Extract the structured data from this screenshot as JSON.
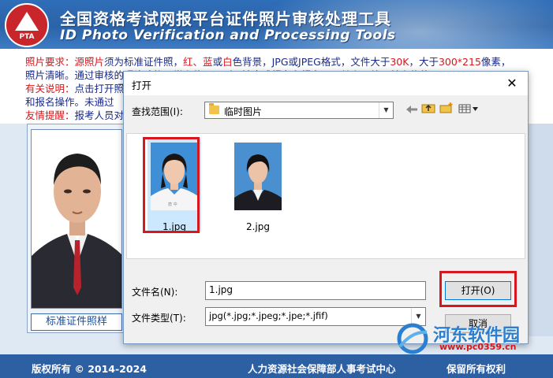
{
  "app": {
    "logo_text": "PTA",
    "title_cn": "全国资格考试网报平台证件照片审核处理工具",
    "title_en": "ID Photo Verification and Processing Tools"
  },
  "notice": {
    "line1_prefix": "照片要求：",
    "line1_a": "源照片",
    "line1_b": "须为标准证件照，",
    "line1_c": "红、蓝",
    "line1_d": "或",
    "line1_e": "白",
    "line1_f": "色背景，JPG或JPEG格式，文件大于",
    "line1_g": "30K",
    "line1_h": "，大于",
    "line1_i": "300*215",
    "line1_j": "像素，",
    "line2": "照片清晰。通过审核的照片才能正常上传，否则无法完成报名和报名。严禁上网处理并上传使用",
    "line3_prefix": "有关说明：",
    "line3": "点击打开照",
    "line4": "和报名操作。未通过",
    "line5_prefix": "友情提醒：",
    "line5": "报考人员对"
  },
  "sample": {
    "label": "标准证件照样"
  },
  "footer": {
    "copyright": "版权所有 ©  2014-2024",
    "org": "人力资源社会保障部人事考试中心",
    "rights": "保留所有权利"
  },
  "dialog": {
    "title": "打开",
    "close_glyph": "✕",
    "look_in_label": "查找范围(I):",
    "look_in_value": "临时图片",
    "toolbar_icons": [
      "back-arrow-icon",
      "up-folder-icon",
      "new-folder-icon",
      "view-menu-icon"
    ],
    "files": [
      {
        "name": "1.jpg",
        "selected": true
      },
      {
        "name": "2.jpg",
        "selected": false
      }
    ],
    "filename_label": "文件名(N):",
    "filename_value": "1.jpg",
    "filetype_label": "文件类型(T):",
    "filetype_value": "jpg(*.jpg;*.jpeg;*.jpe;*.jfif)",
    "open_button": "打开(O)",
    "cancel_button": "取消"
  },
  "watermark": {
    "cn": "河东软件园",
    "url": "www.pc0359.cn"
  },
  "colors": {
    "header_blue": "#2f6eb8",
    "highlight_red": "#d8161d",
    "footer_blue": "#2d5fa3"
  }
}
